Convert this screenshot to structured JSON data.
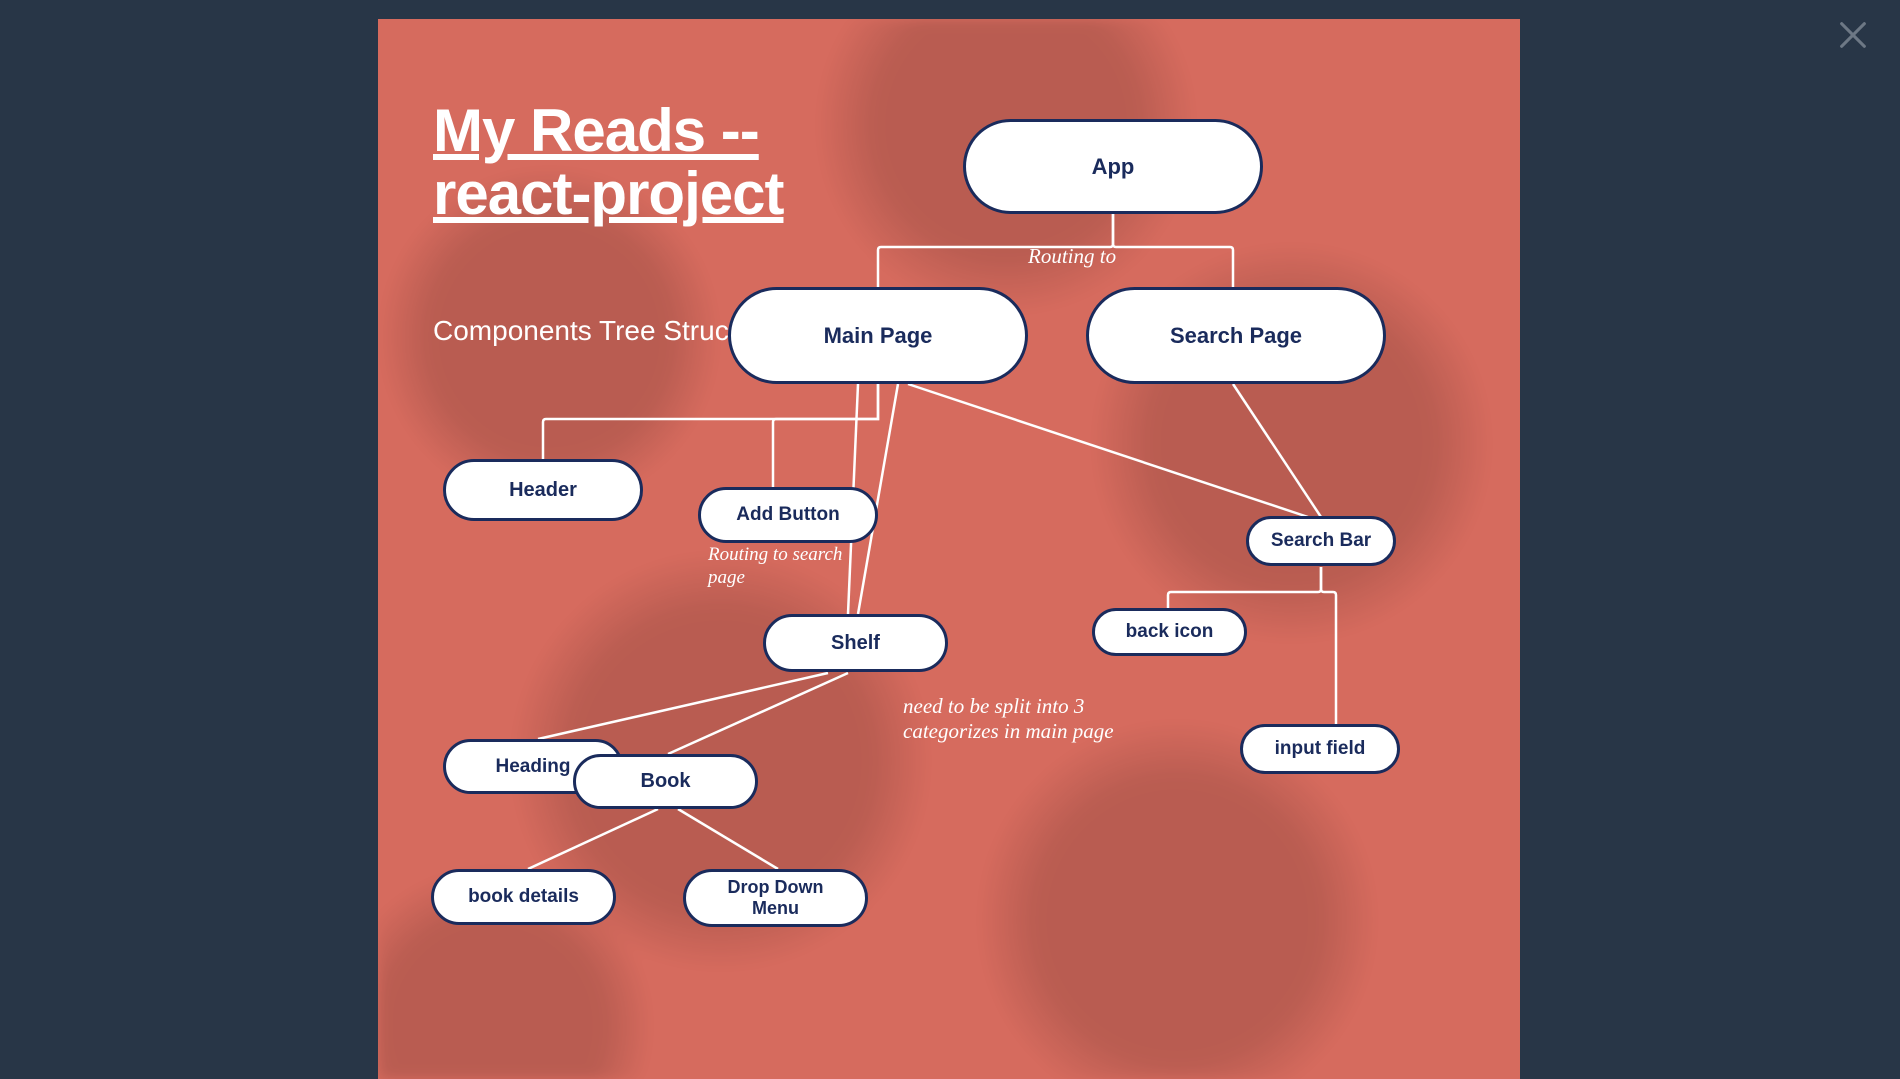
{
  "title": "My Reads -- react-project",
  "subtitle": "Components Tree Structure",
  "annotations": {
    "routing_to": "Routing to",
    "routing_search": "Routing to search page",
    "shelf_note": "need to be split into 3 categorizes  in main page"
  },
  "nodes": {
    "app": {
      "label": "App"
    },
    "main_page": {
      "label": "Main Page"
    },
    "search_page": {
      "label": "Search Page"
    },
    "header": {
      "label": "Header"
    },
    "add_button": {
      "label": "Add Button"
    },
    "shelf": {
      "label": "Shelf"
    },
    "search_bar": {
      "label": "Search Bar"
    },
    "back_icon": {
      "label": "back icon"
    },
    "input_field": {
      "label": "input field"
    },
    "heading": {
      "label": "Heading"
    },
    "book": {
      "label": "Book"
    },
    "book_details": {
      "label": "book details"
    },
    "dropdown": {
      "label": "Drop Down Menu"
    }
  },
  "chart_data": {
    "type": "tree",
    "title": "Components Tree Structure",
    "nodes": [
      "App",
      "Main Page",
      "Search Page",
      "Header",
      "Add Button",
      "Shelf",
      "Search Bar",
      "back icon",
      "input field",
      "Heading",
      "Book",
      "book details",
      "Drop Down Menu"
    ],
    "edges": [
      [
        "App",
        "Main Page"
      ],
      [
        "App",
        "Search Page"
      ],
      [
        "Main Page",
        "Header"
      ],
      [
        "Main Page",
        "Add Button"
      ],
      [
        "Main Page",
        "Shelf"
      ],
      [
        "Main Page",
        "Search Bar"
      ],
      [
        "Search Page",
        "Search Bar"
      ],
      [
        "Shelf",
        "Heading"
      ],
      [
        "Shelf",
        "Book"
      ],
      [
        "Book",
        "book details"
      ],
      [
        "Book",
        "Drop Down Menu"
      ],
      [
        "Search Bar",
        "back icon"
      ],
      [
        "Search Bar",
        "input field"
      ]
    ],
    "edge_annotations": {
      "App→Main Page / App→Search Page": "Routing to",
      "Add Button": "Routing to search page",
      "Shelf": "need to be split into 3 categorizes in main page"
    }
  }
}
